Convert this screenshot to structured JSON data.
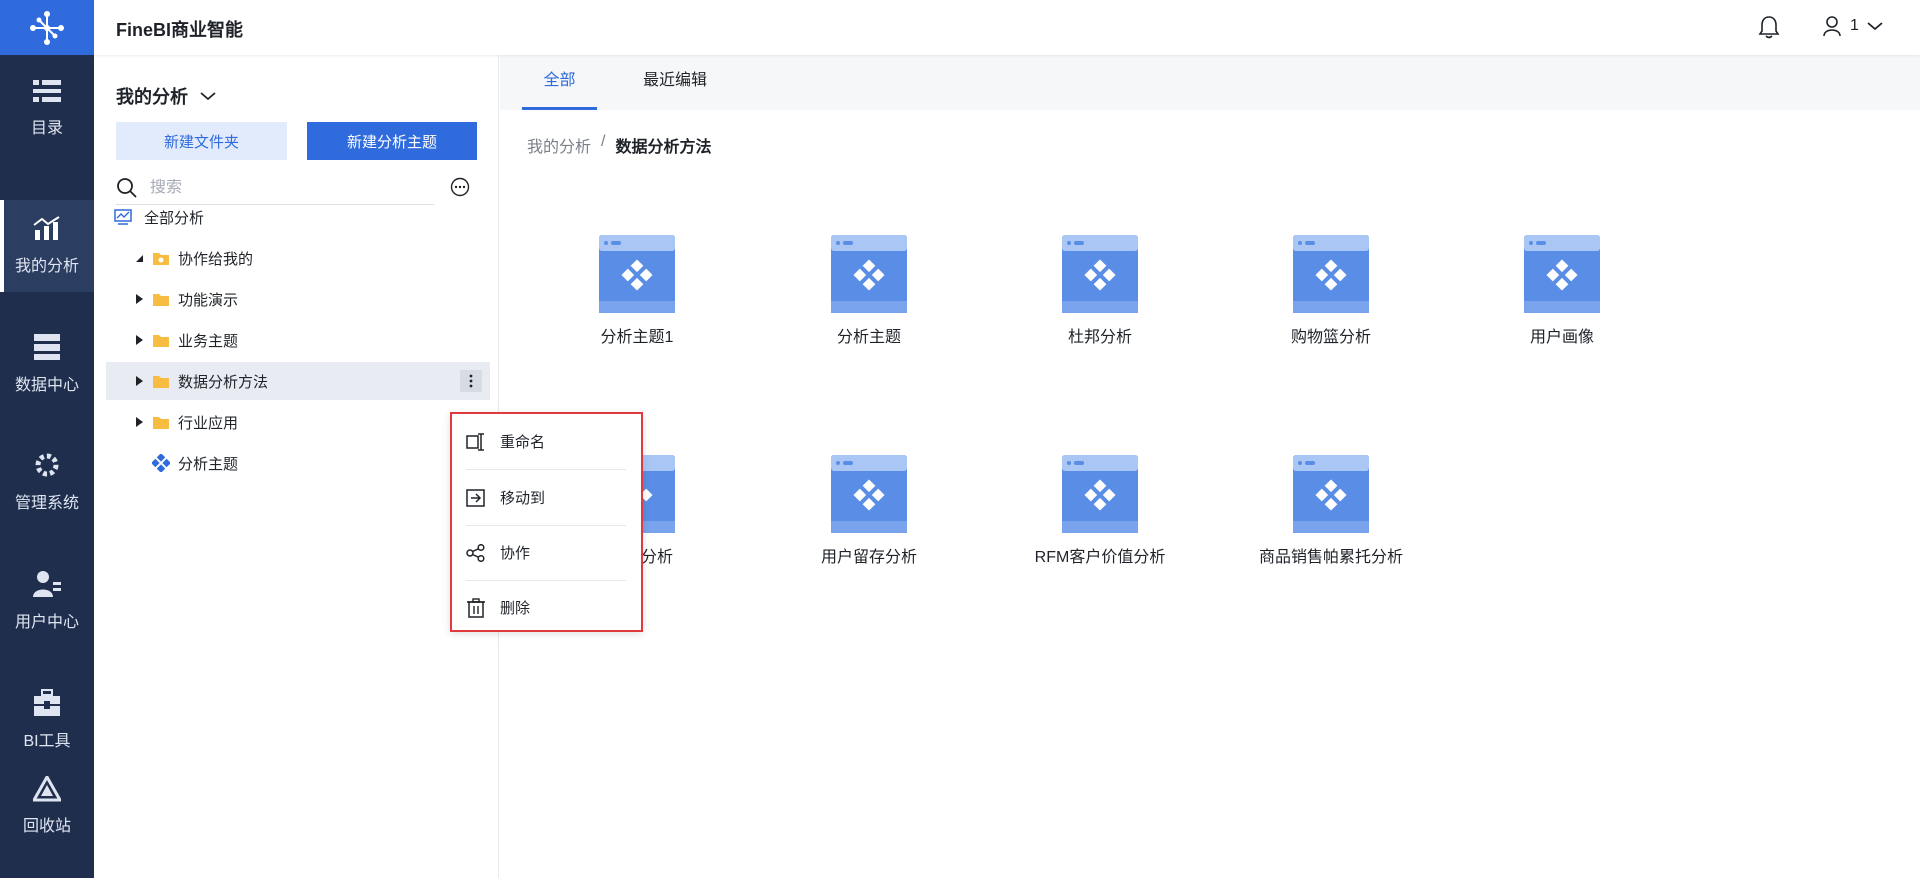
{
  "app": {
    "title": "FineBI商业智能"
  },
  "colors": {
    "accent": "#2f6bdc",
    "nav_bg": "#1f2e4d",
    "highlight": "#e0393e"
  },
  "nav": {
    "items": [
      {
        "label": "目录",
        "icon": "catalog-icon"
      },
      {
        "label": "我的分析",
        "icon": "analysis-chart-icon",
        "active": true
      },
      {
        "label": "数据中心",
        "icon": "database-icon"
      },
      {
        "label": "管理系统",
        "icon": "gear-icon"
      },
      {
        "label": "用户中心",
        "icon": "user-manage-icon"
      },
      {
        "label": "BI工具",
        "icon": "toolbox-icon"
      },
      {
        "label": "回收站",
        "icon": "recycle-icon"
      }
    ]
  },
  "header": {
    "user_label": "1"
  },
  "sidebar": {
    "title": "我的分析",
    "new_folder": "新建文件夹",
    "new_topic": "新建分析主题",
    "search_placeholder": "搜索",
    "tree": [
      {
        "label": "全部分析",
        "icon": "all-analysis-icon"
      },
      {
        "label": "协作给我的",
        "icon": "shared-folder-icon",
        "expanded": true
      },
      {
        "label": "功能演示",
        "icon": "folder-icon"
      },
      {
        "label": "业务主题",
        "icon": "folder-icon"
      },
      {
        "label": "数据分析方法",
        "icon": "folder-icon",
        "selected": true
      },
      {
        "label": "行业应用",
        "icon": "folder-icon"
      },
      {
        "label": "分析主题",
        "icon": "analysis-topic-icon"
      }
    ]
  },
  "context_menu": {
    "items": [
      {
        "label": "重命名",
        "icon": "rename-icon"
      },
      {
        "label": "移动到",
        "icon": "move-to-icon"
      },
      {
        "label": "协作",
        "icon": "share-icon"
      },
      {
        "label": "删除",
        "icon": "trash-icon"
      }
    ]
  },
  "main": {
    "tabs": [
      {
        "label": "全部"
      },
      {
        "label": "最近编辑"
      }
    ],
    "breadcrumb": {
      "root": "我的分析",
      "sep": "/",
      "current": "数据分析方法"
    },
    "cards": [
      {
        "label": "分析主题1"
      },
      {
        "label": "分析主题"
      },
      {
        "label": "杜邦分析"
      },
      {
        "label": "购物篮分析"
      },
      {
        "label": "用户画像"
      },
      {
        "label": "分析"
      },
      {
        "label": "用户留存分析"
      },
      {
        "label": "RFM客户价值分析"
      },
      {
        "label": "商品销售帕累托分析"
      }
    ]
  }
}
